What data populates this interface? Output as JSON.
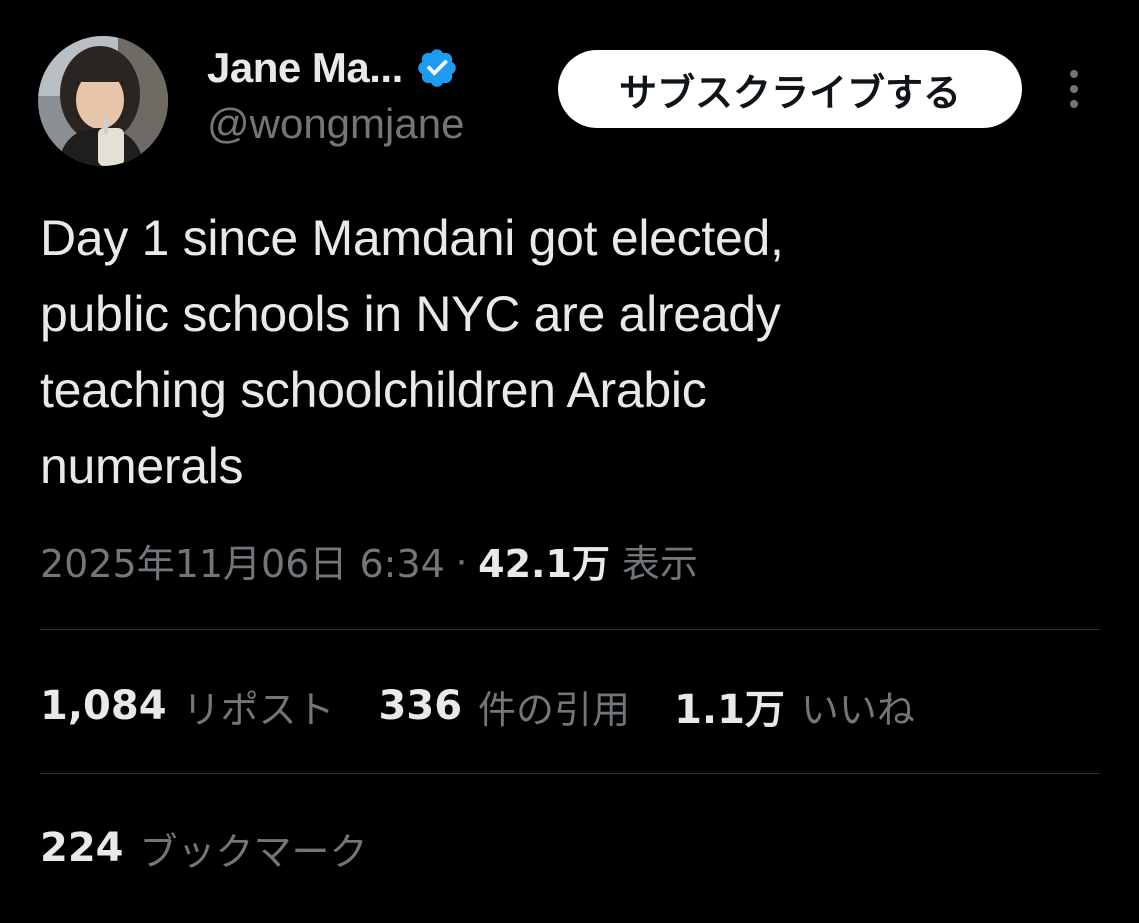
{
  "author": {
    "display_name": "Jane Ma...",
    "handle": "@wongmjane",
    "verified_color": "#1d9bf0"
  },
  "header": {
    "subscribe_label": "サブスクライブする",
    "more_icon": "more-vertical-icon"
  },
  "tweet": {
    "lines": [
      "Day 1 since Mamdani got elected,",
      "public schools in NYC are already",
      "teaching schoolchildren Arabic",
      "numerals"
    ]
  },
  "meta": {
    "timestamp": "2025年11月06日 6:34",
    "separator": "·",
    "views_count": "42.1万",
    "views_label": "表示"
  },
  "stats": {
    "reposts_count": "1,084",
    "reposts_label": "リポスト",
    "quotes_count": "336",
    "quotes_label": "件の引用",
    "likes_count": "1.1万",
    "likes_label": "いいね",
    "bookmarks_count": "224",
    "bookmarks_label": "ブックマーク"
  },
  "colors": {
    "background": "#000000",
    "text_primary": "#e7e9ea",
    "text_secondary": "#71767b",
    "divider": "#2f3336",
    "button_bg": "#ffffff"
  }
}
